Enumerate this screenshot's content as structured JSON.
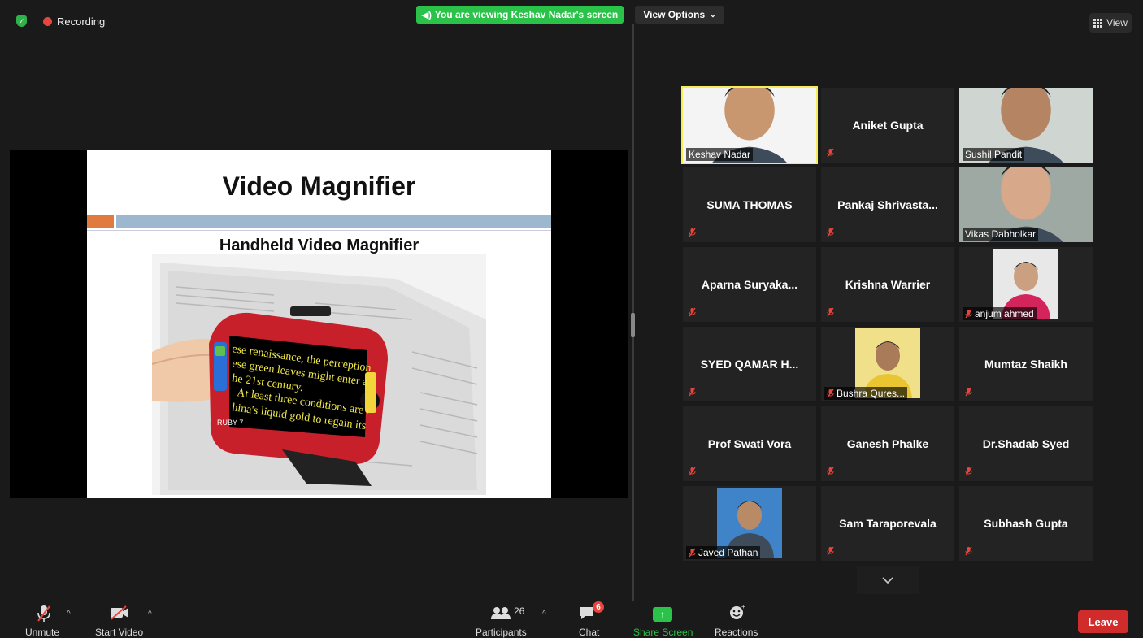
{
  "status": {
    "recording_label": "Recording",
    "viewing_banner": "You are viewing Keshav Nadar's screen",
    "view_options_label": "View Options",
    "view_label": "View"
  },
  "slide": {
    "title": "Video Magnifier",
    "subtitle": "Handheld Video Magnifier",
    "magnifier_text": [
      "ese renaissance, the perception",
      "ese green leaves might enter a",
      "he 21st century.",
      "At least three conditions are r",
      "hina's liquid gold to regain its"
    ]
  },
  "participants_grid": [
    {
      "name": "Keshav Nadar",
      "video": true,
      "active": true,
      "muted": false
    },
    {
      "name": "Aniket Gupta",
      "video": false,
      "muted": true
    },
    {
      "name": "Sushil Pandit",
      "video": true,
      "muted": false
    },
    {
      "name": "SUMA THOMAS",
      "video": false,
      "muted": true
    },
    {
      "name": "Pankaj  Shrivasta...",
      "video": false,
      "muted": true
    },
    {
      "name": "Vikas Dabholkar",
      "video": true,
      "muted": false
    },
    {
      "name": "Aparna  Suryaka...",
      "video": false,
      "muted": true
    },
    {
      "name": "Krishna Warrier",
      "video": false,
      "muted": true
    },
    {
      "name": "anjum ahmed",
      "video": true,
      "muted": true
    },
    {
      "name": "SYED  QAMAR  H...",
      "video": false,
      "muted": true
    },
    {
      "name": "Bushra Qures...",
      "video": true,
      "muted": true
    },
    {
      "name": "Mumtaz Shaikh",
      "video": false,
      "muted": true
    },
    {
      "name": "Prof Swati Vora",
      "video": false,
      "muted": true
    },
    {
      "name": "Ganesh Phalke",
      "video": false,
      "muted": true
    },
    {
      "name": "Dr.Shadab Syed",
      "video": false,
      "muted": true
    },
    {
      "name": "Javed Pathan",
      "video": true,
      "muted": true
    },
    {
      "name": "Sam Taraporevala",
      "video": false,
      "muted": true
    },
    {
      "name": "Subhash Gupta",
      "video": false,
      "muted": true
    }
  ],
  "toolbar": {
    "unmute_label": "Unmute",
    "start_video_label": "Start Video",
    "participants_label": "Participants",
    "participants_count": "26",
    "chat_label": "Chat",
    "chat_badge": "6",
    "share_screen_label": "Share Screen",
    "reactions_label": "Reactions",
    "leave_label": "Leave"
  },
  "colors": {
    "green": "#2bc24a",
    "leave_red": "#d12c2c",
    "active_speaker": "#f5ec5a",
    "tile_bg": "#232323"
  }
}
